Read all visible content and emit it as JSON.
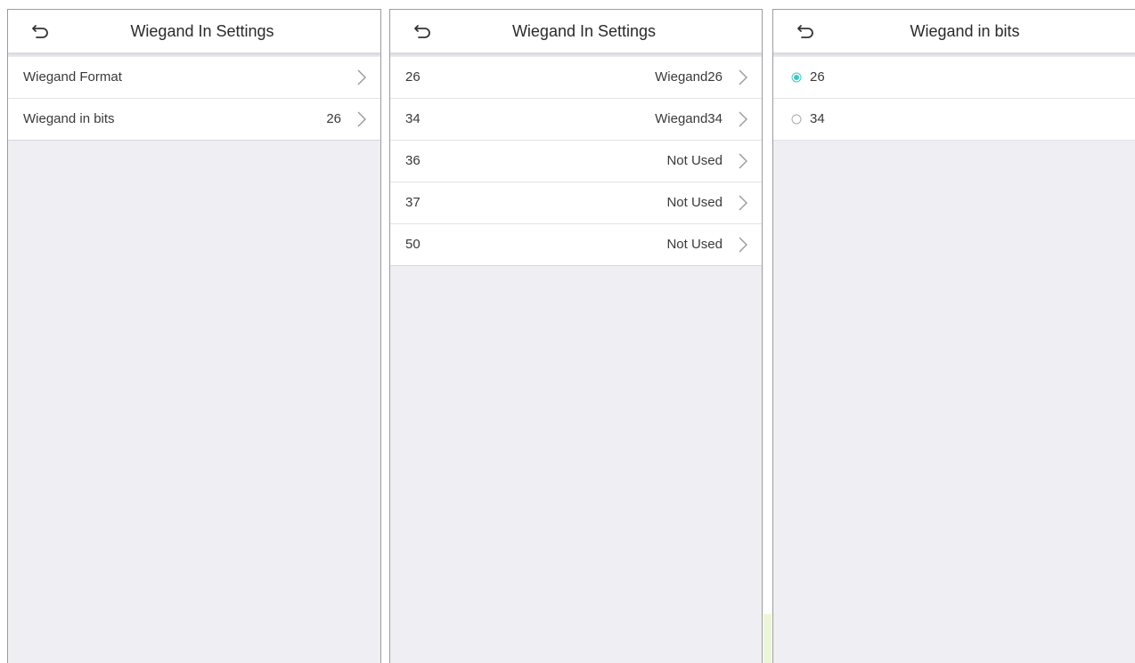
{
  "screens": [
    {
      "title": "Wiegand In Settings",
      "rows": [
        {
          "label": "Wiegand Format",
          "value": ""
        },
        {
          "label": "Wiegand in bits",
          "value": "26"
        }
      ]
    },
    {
      "title": "Wiegand In Settings",
      "rows": [
        {
          "label": "26",
          "value": "Wiegand26"
        },
        {
          "label": "34",
          "value": "Wiegand34"
        },
        {
          "label": "36",
          "value": "Not Used"
        },
        {
          "label": "37",
          "value": "Not Used"
        },
        {
          "label": "50",
          "value": "Not Used"
        }
      ]
    },
    {
      "title": "Wiegand in bits",
      "options": [
        {
          "label": "26",
          "selected": true
        },
        {
          "label": "34",
          "selected": false
        }
      ]
    }
  ],
  "icons": {
    "back": "back-arrow-icon",
    "chevron": "chevron-right-icon",
    "radio": "radio-button-icon"
  },
  "colors": {
    "background": "#efeef3",
    "surface": "#ffffff",
    "radio_selected": "#3bc7c3",
    "text": "#3a3a3a"
  }
}
